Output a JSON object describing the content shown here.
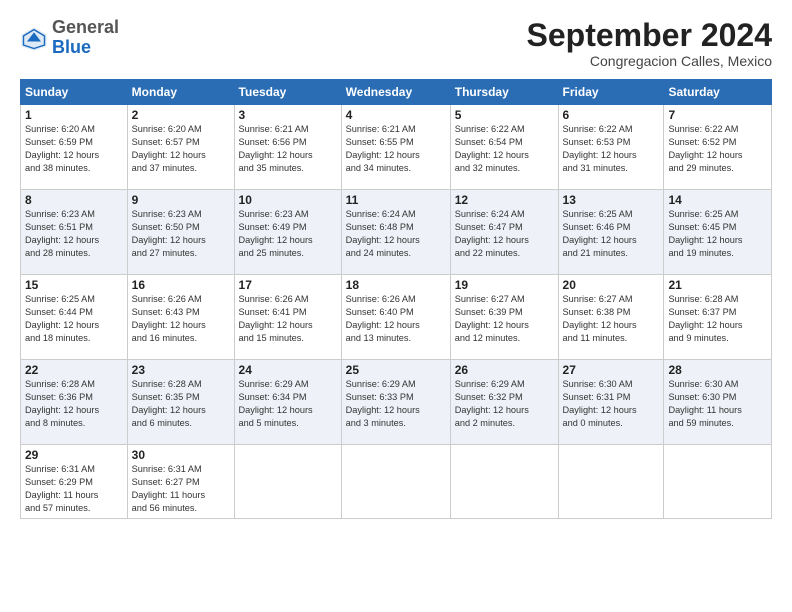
{
  "header": {
    "logo_general": "General",
    "logo_blue": "Blue",
    "month_title": "September 2024",
    "location": "Congregacion Calles, Mexico"
  },
  "weekdays": [
    "Sunday",
    "Monday",
    "Tuesday",
    "Wednesday",
    "Thursday",
    "Friday",
    "Saturday"
  ],
  "weeks": [
    [
      {
        "day": "1",
        "info": "Sunrise: 6:20 AM\nSunset: 6:59 PM\nDaylight: 12 hours\nand 38 minutes."
      },
      {
        "day": "2",
        "info": "Sunrise: 6:20 AM\nSunset: 6:57 PM\nDaylight: 12 hours\nand 37 minutes."
      },
      {
        "day": "3",
        "info": "Sunrise: 6:21 AM\nSunset: 6:56 PM\nDaylight: 12 hours\nand 35 minutes."
      },
      {
        "day": "4",
        "info": "Sunrise: 6:21 AM\nSunset: 6:55 PM\nDaylight: 12 hours\nand 34 minutes."
      },
      {
        "day": "5",
        "info": "Sunrise: 6:22 AM\nSunset: 6:54 PM\nDaylight: 12 hours\nand 32 minutes."
      },
      {
        "day": "6",
        "info": "Sunrise: 6:22 AM\nSunset: 6:53 PM\nDaylight: 12 hours\nand 31 minutes."
      },
      {
        "day": "7",
        "info": "Sunrise: 6:22 AM\nSunset: 6:52 PM\nDaylight: 12 hours\nand 29 minutes."
      }
    ],
    [
      {
        "day": "8",
        "info": "Sunrise: 6:23 AM\nSunset: 6:51 PM\nDaylight: 12 hours\nand 28 minutes."
      },
      {
        "day": "9",
        "info": "Sunrise: 6:23 AM\nSunset: 6:50 PM\nDaylight: 12 hours\nand 27 minutes."
      },
      {
        "day": "10",
        "info": "Sunrise: 6:23 AM\nSunset: 6:49 PM\nDaylight: 12 hours\nand 25 minutes."
      },
      {
        "day": "11",
        "info": "Sunrise: 6:24 AM\nSunset: 6:48 PM\nDaylight: 12 hours\nand 24 minutes."
      },
      {
        "day": "12",
        "info": "Sunrise: 6:24 AM\nSunset: 6:47 PM\nDaylight: 12 hours\nand 22 minutes."
      },
      {
        "day": "13",
        "info": "Sunrise: 6:25 AM\nSunset: 6:46 PM\nDaylight: 12 hours\nand 21 minutes."
      },
      {
        "day": "14",
        "info": "Sunrise: 6:25 AM\nSunset: 6:45 PM\nDaylight: 12 hours\nand 19 minutes."
      }
    ],
    [
      {
        "day": "15",
        "info": "Sunrise: 6:25 AM\nSunset: 6:44 PM\nDaylight: 12 hours\nand 18 minutes."
      },
      {
        "day": "16",
        "info": "Sunrise: 6:26 AM\nSunset: 6:43 PM\nDaylight: 12 hours\nand 16 minutes."
      },
      {
        "day": "17",
        "info": "Sunrise: 6:26 AM\nSunset: 6:41 PM\nDaylight: 12 hours\nand 15 minutes."
      },
      {
        "day": "18",
        "info": "Sunrise: 6:26 AM\nSunset: 6:40 PM\nDaylight: 12 hours\nand 13 minutes."
      },
      {
        "day": "19",
        "info": "Sunrise: 6:27 AM\nSunset: 6:39 PM\nDaylight: 12 hours\nand 12 minutes."
      },
      {
        "day": "20",
        "info": "Sunrise: 6:27 AM\nSunset: 6:38 PM\nDaylight: 12 hours\nand 11 minutes."
      },
      {
        "day": "21",
        "info": "Sunrise: 6:28 AM\nSunset: 6:37 PM\nDaylight: 12 hours\nand 9 minutes."
      }
    ],
    [
      {
        "day": "22",
        "info": "Sunrise: 6:28 AM\nSunset: 6:36 PM\nDaylight: 12 hours\nand 8 minutes."
      },
      {
        "day": "23",
        "info": "Sunrise: 6:28 AM\nSunset: 6:35 PM\nDaylight: 12 hours\nand 6 minutes."
      },
      {
        "day": "24",
        "info": "Sunrise: 6:29 AM\nSunset: 6:34 PM\nDaylight: 12 hours\nand 5 minutes."
      },
      {
        "day": "25",
        "info": "Sunrise: 6:29 AM\nSunset: 6:33 PM\nDaylight: 12 hours\nand 3 minutes."
      },
      {
        "day": "26",
        "info": "Sunrise: 6:29 AM\nSunset: 6:32 PM\nDaylight: 12 hours\nand 2 minutes."
      },
      {
        "day": "27",
        "info": "Sunrise: 6:30 AM\nSunset: 6:31 PM\nDaylight: 12 hours\nand 0 minutes."
      },
      {
        "day": "28",
        "info": "Sunrise: 6:30 AM\nSunset: 6:30 PM\nDaylight: 11 hours\nand 59 minutes."
      }
    ],
    [
      {
        "day": "29",
        "info": "Sunrise: 6:31 AM\nSunset: 6:29 PM\nDaylight: 11 hours\nand 57 minutes."
      },
      {
        "day": "30",
        "info": "Sunrise: 6:31 AM\nSunset: 6:27 PM\nDaylight: 11 hours\nand 56 minutes."
      },
      {
        "day": "",
        "info": ""
      },
      {
        "day": "",
        "info": ""
      },
      {
        "day": "",
        "info": ""
      },
      {
        "day": "",
        "info": ""
      },
      {
        "day": "",
        "info": ""
      }
    ]
  ]
}
